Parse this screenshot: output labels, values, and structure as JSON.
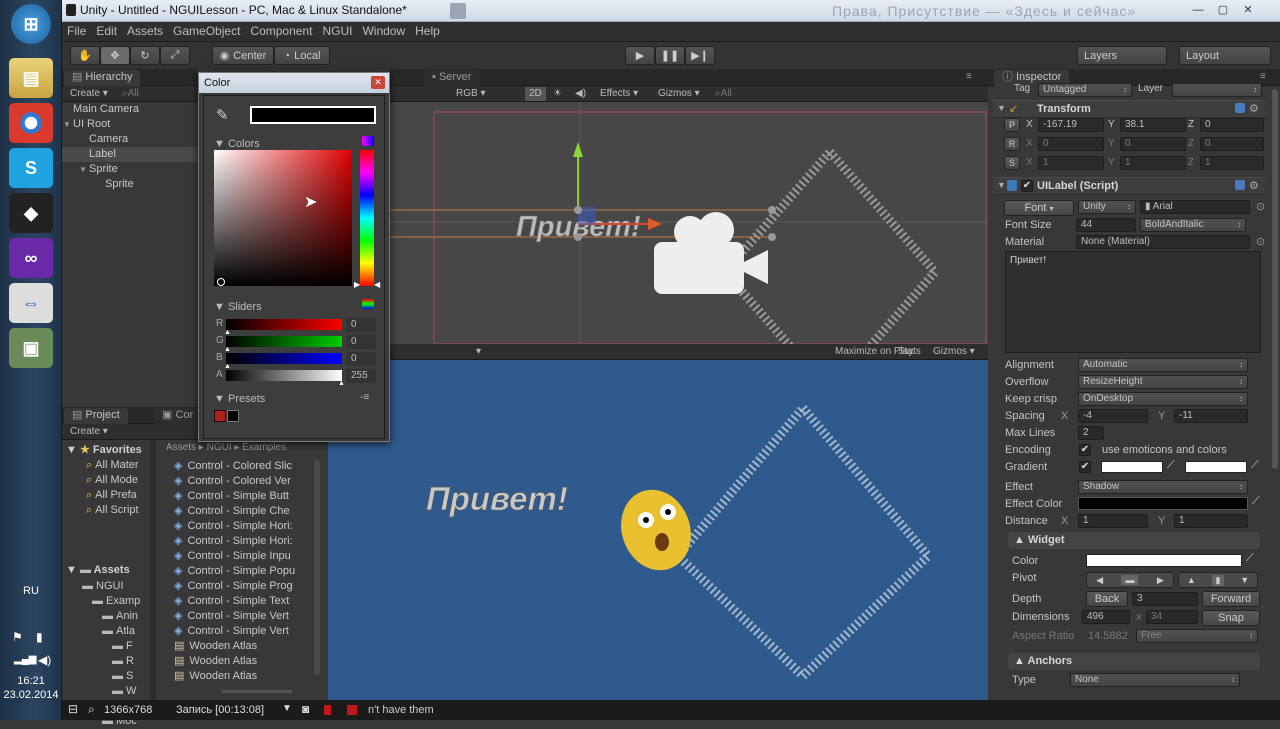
{
  "taskbar": {
    "lang": "RU",
    "time": "16:21",
    "date": "23.02.2014"
  },
  "window": {
    "title": "Unity - Untitled - NGUILesson - PC, Mac & Linux Standalone*",
    "background_text": "Права, Присутствие — «Здесь и сейчас»"
  },
  "menu": [
    "File",
    "Edit",
    "Assets",
    "GameObject",
    "Component",
    "NGUI",
    "Window",
    "Help"
  ],
  "toolbar": {
    "center": "Center",
    "local": "Local",
    "layers": "Layers",
    "layout": "Layout"
  },
  "hierarchy": {
    "tab": "Hierarchy",
    "create": "Create",
    "search": "All",
    "items": [
      {
        "label": "Main Camera",
        "indent": 0
      },
      {
        "label": "UI Root",
        "indent": 0,
        "arrow": "▼"
      },
      {
        "label": "Camera",
        "indent": 1
      },
      {
        "label": "Label",
        "indent": 1,
        "selected": true
      },
      {
        "label": "Sprite",
        "indent": 1,
        "arrow": "▼"
      },
      {
        "label": "Sprite",
        "indent": 2
      }
    ]
  },
  "color_dialog": {
    "title": "Color",
    "colors_label": "Colors",
    "sliders_label": "Sliders",
    "presets_label": "Presets",
    "sliders": [
      {
        "name": "R",
        "value": "0"
      },
      {
        "name": "G",
        "value": "0"
      },
      {
        "name": "B",
        "value": "0"
      },
      {
        "name": "A",
        "value": "255"
      }
    ]
  },
  "scene": {
    "tab_server": "Server",
    "rgb": "RGB",
    "mode2d": "2D",
    "effects": "Effects",
    "gizmos": "Gizmos",
    "search": "All",
    "label_text": "Привет!"
  },
  "game": {
    "maximize": "Maximize on Play",
    "stats": "Stats",
    "gizmos": "Gizmos",
    "label_text": "Привет!",
    "bottom_text": "n't have them"
  },
  "project": {
    "tab": "Project",
    "tab2": "Cor",
    "create": "Create",
    "favorites": "Favorites",
    "fav_items": [
      "All Mater",
      "All Mode",
      "All Prefa",
      "All Script"
    ],
    "assets": "Assets",
    "tree": [
      {
        "label": "NGUI",
        "indent": 1
      },
      {
        "label": "Examp",
        "indent": 2
      },
      {
        "label": "Anin",
        "indent": 3
      },
      {
        "label": "Atla",
        "indent": 3
      },
      {
        "label": "F",
        "indent": 4
      },
      {
        "label": "R",
        "indent": 4
      },
      {
        "label": "S",
        "indent": 4
      },
      {
        "label": "W",
        "indent": 4
      },
      {
        "label": "Mat",
        "indent": 3
      },
      {
        "label": "Moc",
        "indent": 3
      }
    ],
    "breadcrumb": [
      "Assets",
      "NGUI",
      "Examples"
    ],
    "files": [
      "Control - Colored Slic",
      "Control - Colored Ver",
      "Control - Simple Butt",
      "Control - Simple Che",
      "Control - Simple Hori:",
      "Control - Simple Hori:",
      "Control - Simple Inpu",
      "Control - Simple Popu",
      "Control - Simple Prog",
      "Control - Simple Text",
      "Control - Simple Vert",
      "Control - Simple Vert",
      "Wooden Atlas",
      "Wooden Atlas",
      "Wooden Atlas"
    ]
  },
  "inspector": {
    "tab": "Inspector",
    "tag_label": "Tag",
    "tag": "Untagged",
    "layer_label": "Layer",
    "transform": {
      "title": "Transform",
      "p": {
        "x": "-167.19",
        "y": "38.1",
        "z": "0"
      },
      "r": {
        "x": "0",
        "y": "0",
        "z": "0"
      },
      "s": {
        "x": "1",
        "y": "1",
        "z": "1"
      }
    },
    "uilabel": {
      "title": "UILabel (Script)",
      "font_btn": "Font",
      "font_src": "Unity",
      "font_name": "Arial",
      "font_size_label": "Font Size",
      "font_size": "44",
      "font_style": "BoldAndItalic",
      "material_label": "Material",
      "material": "None (Material)",
      "text": "Привет!",
      "rows": [
        {
          "label": "Alignment",
          "value": "Automatic"
        },
        {
          "label": "Overflow",
          "value": "ResizeHeight"
        },
        {
          "label": "Keep crisp",
          "value": "OnDesktop"
        }
      ],
      "spacing_label": "Spacing",
      "spacing_x": "-4",
      "spacing_y": "-11",
      "maxlines_label": "Max Lines",
      "maxlines": "2",
      "encoding_label": "Encoding",
      "encoding_text": "use emoticons and colors",
      "gradient_label": "Gradient",
      "effect_label": "Effect",
      "effect": "Shadow",
      "effect_color_label": "Effect Color",
      "distance_label": "Distance",
      "distance_x": "1",
      "distance_y": "1"
    },
    "widget": {
      "title": "Widget",
      "color_label": "Color",
      "pivot_label": "Pivot",
      "depth_label": "Depth",
      "back": "Back",
      "depth": "3",
      "forward": "Forward",
      "dims_label": "Dimensions",
      "width": "496",
      "height": "34",
      "snap": "Snap",
      "aspect_label": "Aspect Ratio",
      "aspect": "14.5882",
      "aspect_mode": "Free"
    },
    "anchors": {
      "title": "Anchors",
      "type_label": "Type",
      "type": "None"
    }
  },
  "status": {
    "resolution": "1366x768",
    "recording": "Запись [00:13:08]"
  },
  "colors": {
    "accent": "#3d6ea8",
    "game_bg": "#2e5a8e",
    "scene_bg": "#474747"
  }
}
